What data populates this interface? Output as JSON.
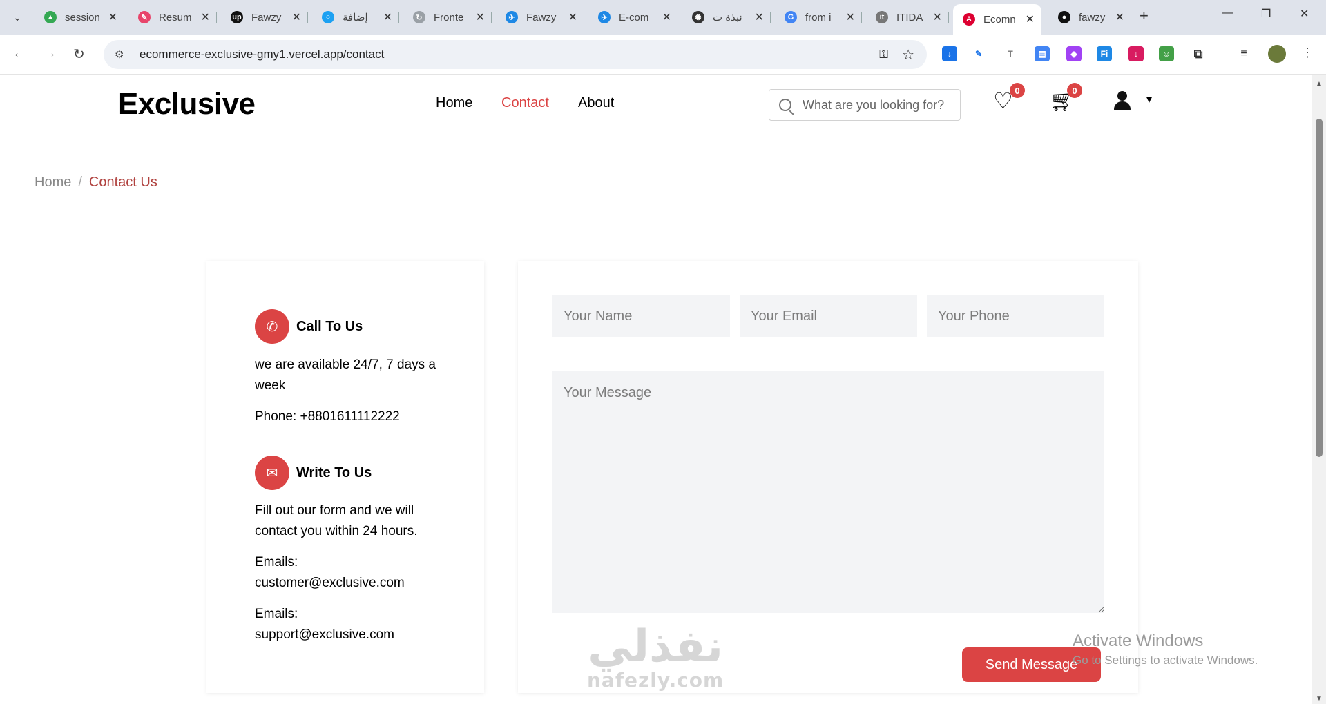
{
  "browser": {
    "tabs": [
      {
        "title": "session",
        "fav_color": "#34a853",
        "fav_char": "▲"
      },
      {
        "title": "Resum",
        "fav_color": "#e8456b",
        "fav_char": "✎"
      },
      {
        "title": "Fawzy",
        "fav_color": "#111111",
        "fav_char": "up"
      },
      {
        "title": "إضافة",
        "fav_color": "#1da1f2",
        "fav_char": "○"
      },
      {
        "title": "Fronte",
        "fav_color": "#9aa0a6",
        "fav_char": "↻"
      },
      {
        "title": "Fawzy",
        "fav_color": "#1e88e5",
        "fav_char": "✈"
      },
      {
        "title": "E-com",
        "fav_color": "#1e88e5",
        "fav_char": "✈"
      },
      {
        "title": "نبذة ت",
        "fav_color": "#333333",
        "fav_char": "✺"
      },
      {
        "title": "from i",
        "fav_color": "#4285f4",
        "fav_char": "G"
      },
      {
        "title": "ITIDA",
        "fav_color": "#777777",
        "fav_char": "it"
      },
      {
        "title": "Ecomn",
        "fav_color": "#dd0031",
        "fav_char": "A"
      },
      {
        "title": "fawzy",
        "fav_color": "#111111",
        "fav_char": "●"
      }
    ],
    "url": "ecommerce-exclusive-gmy1.vercel.app/contact"
  },
  "header": {
    "logo": "Exclusive",
    "nav": {
      "home": "Home",
      "contact": "Contact",
      "about": "About"
    },
    "search_placeholder": "What are you looking for?",
    "wishlist_count": "0",
    "cart_count": "0",
    "accent_color": "#db4444"
  },
  "breadcrumb": {
    "home": "Home",
    "separator": "/",
    "current": "Contact Us"
  },
  "contact": {
    "call": {
      "title": "Call To Us",
      "text": "we are available 24/7, 7 days a week",
      "phone": "Phone: +8801611112222"
    },
    "write": {
      "title": "Write To Us",
      "text": "Fill out our form and we will contact you within 24 hours.",
      "email1_label": "Emails:",
      "email1": "customer@exclusive.com",
      "email2_label": "Emails:",
      "email2": "support@exclusive.com"
    }
  },
  "form": {
    "name_placeholder": "Your Name",
    "email_placeholder": "Your Email",
    "phone_placeholder": "Your Phone",
    "message_placeholder": "Your Message",
    "send_label": "Send Message"
  },
  "watermark": {
    "arabic": "نفذلي",
    "latin": "nafezly.com"
  },
  "activation": {
    "title": "Activate Windows",
    "subtitle": "Go to Settings to activate Windows."
  }
}
